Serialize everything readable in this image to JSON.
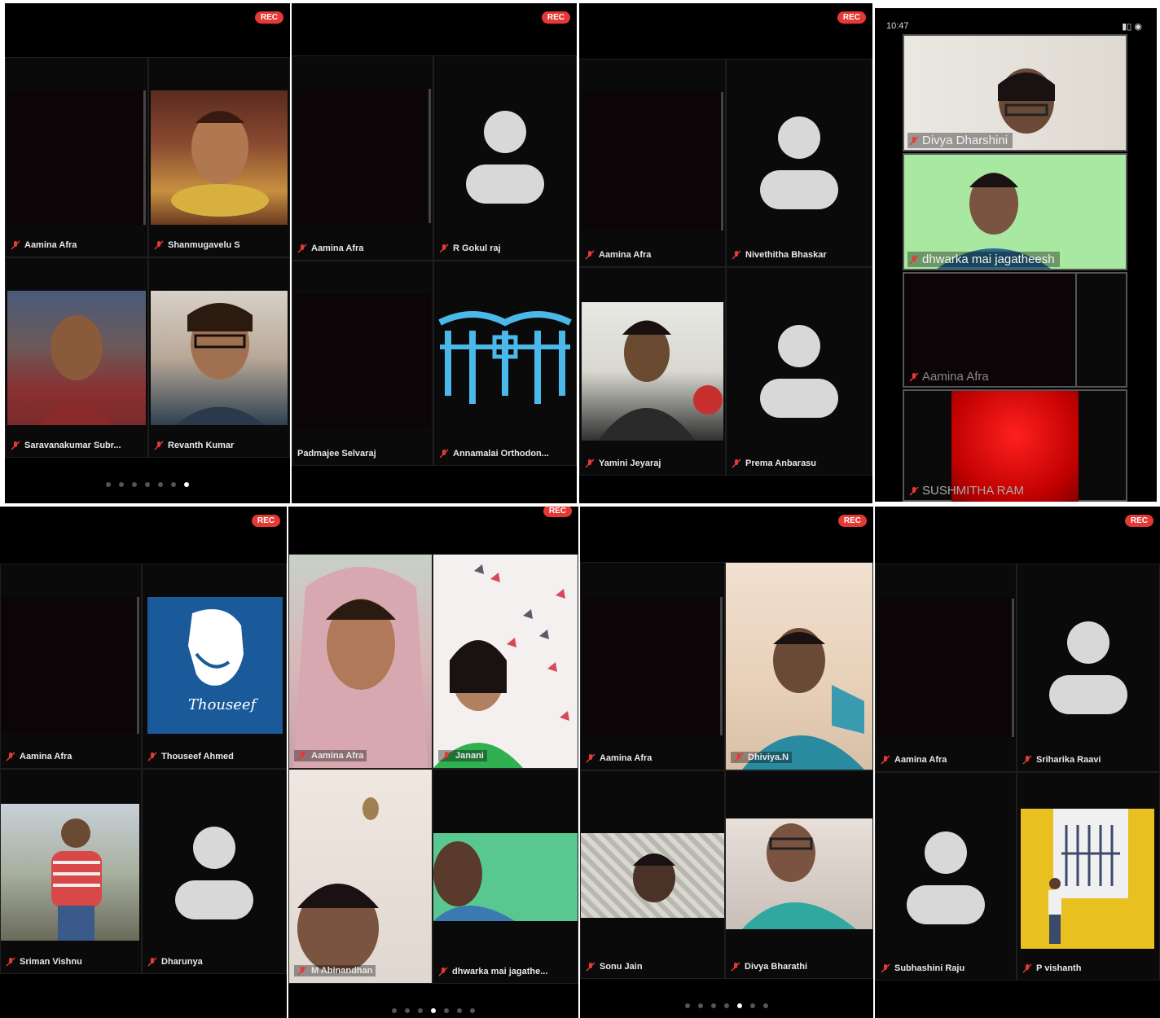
{
  "rec_label": "REC",
  "status_time": "10:47",
  "panel1": {
    "names": [
      "Aamina Afra",
      "Shanmugavelu S",
      "Saravanakumar Subr...",
      "Revanth Kumar"
    ],
    "dots": 7,
    "active_dot": 6
  },
  "panel2": {
    "names": [
      "Aamina Afra",
      "R Gokul raj",
      "Padmajee Selvaraj",
      "Annamalai Orthodon..."
    ]
  },
  "panel3": {
    "names": [
      "Aamina Afra",
      "Nivethitha Bhaskar",
      "Yamini Jeyaraj",
      "Prema Anbarasu"
    ]
  },
  "panel4": {
    "names": [
      "Divya Dharshini",
      "dhwarka mai jagatheesh",
      "Aamina Afra",
      "SUSHMITHA RAM"
    ]
  },
  "panel5": {
    "names": [
      "Aamina Afra",
      "Thouseef Ahmed",
      "Sriman Vishnu",
      "Dharunya"
    ],
    "logo_text": "Thouseef"
  },
  "panel6": {
    "names": [
      "Aamina Afra",
      "Janani",
      "M Abinandhan",
      "dhwarka mai jagathe..."
    ],
    "dots": 7,
    "active_dot": 3
  },
  "panel7": {
    "names": [
      "Aamina Afra",
      "Dhiviya.N",
      "Sonu Jain",
      "Divya Bharathi"
    ],
    "dots": 7,
    "active_dot": 4
  },
  "panel8": {
    "names": [
      "Aamina Afra",
      "Sriharika Raavi",
      "Subhashini Raju",
      "P vishanth"
    ]
  },
  "colors": {
    "rec": "#e53935",
    "mic_muted": "#e53935",
    "background": "#000000"
  }
}
